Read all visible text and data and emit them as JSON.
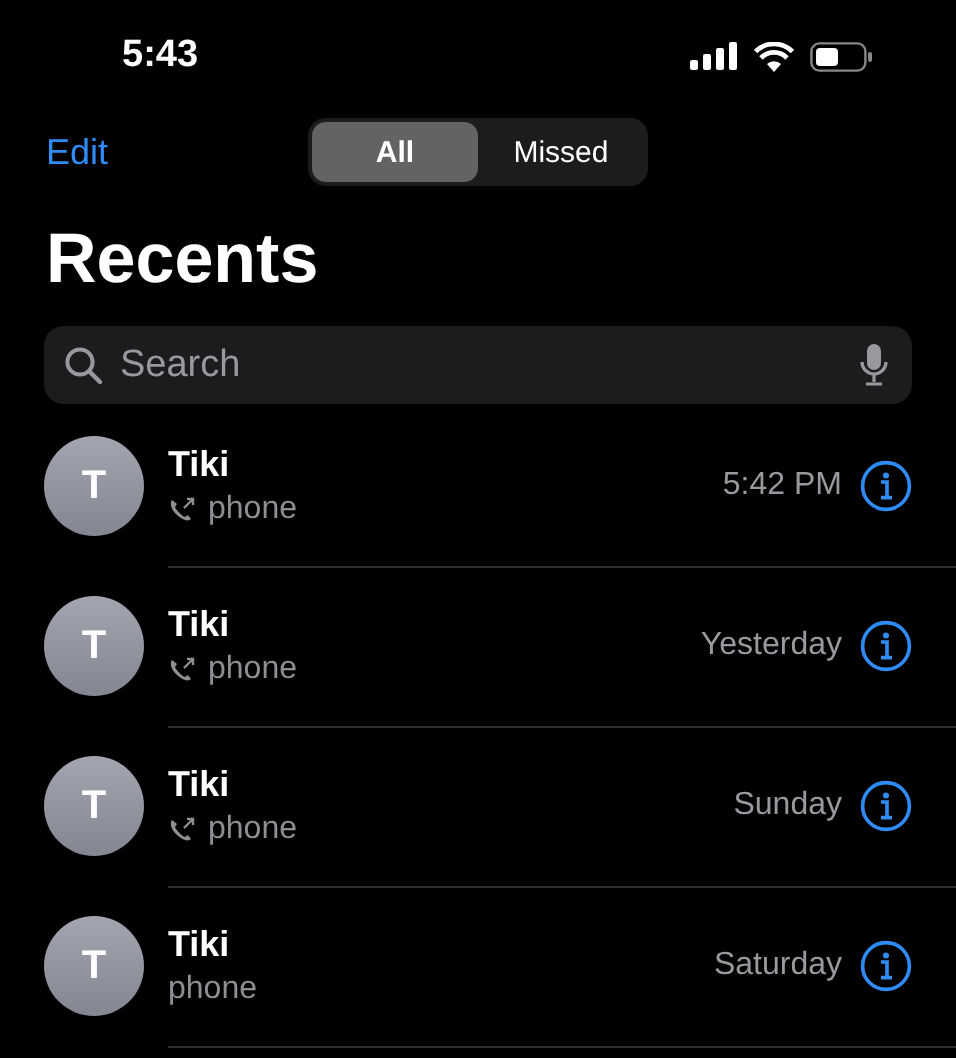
{
  "status_bar": {
    "time": "5:43"
  },
  "nav": {
    "edit": "Edit",
    "segments": [
      {
        "label": "All",
        "selected": true
      },
      {
        "label": "Missed",
        "selected": false
      }
    ]
  },
  "title": "Recents",
  "search": {
    "placeholder": "Search"
  },
  "calls": [
    {
      "initial": "T",
      "name": "Tiki",
      "type": "phone",
      "outgoing": true,
      "when": "5:42 PM"
    },
    {
      "initial": "T",
      "name": "Tiki",
      "type": "phone",
      "outgoing": true,
      "when": "Yesterday"
    },
    {
      "initial": "T",
      "name": "Tiki",
      "type": "phone",
      "outgoing": true,
      "when": "Sunday"
    },
    {
      "initial": "T",
      "name": "Tiki",
      "type": "phone",
      "outgoing": false,
      "when": "Saturday"
    }
  ]
}
